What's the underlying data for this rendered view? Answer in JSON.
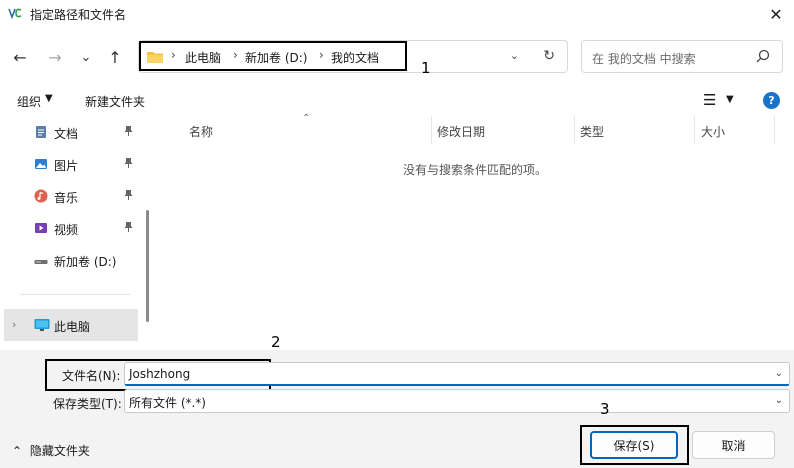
{
  "window": {
    "title": "指定路径和文件名",
    "close_glyph": "✕"
  },
  "nav": {
    "back_glyph": "←",
    "forward_glyph": "→",
    "recent_glyph": "⌄",
    "up_glyph": "↑"
  },
  "address": {
    "crumbs": [
      "此电脑",
      "新加卷 (D:)",
      "我的文档"
    ],
    "separator": "›",
    "dropdown_glyph": "⌄",
    "refresh_glyph": "↻"
  },
  "search": {
    "placeholder": "在 我的文档 中搜索"
  },
  "toolbar": {
    "organize": "组织",
    "organize_caret": "▼",
    "new_folder": "新建文件夹",
    "view_glyph": "☰",
    "view_caret": "▼",
    "help": "?"
  },
  "sidebar": {
    "items": [
      {
        "label": "文档",
        "icon": "document-icon",
        "pinned": true
      },
      {
        "label": "图片",
        "icon": "pictures-icon",
        "pinned": true
      },
      {
        "label": "音乐",
        "icon": "music-icon",
        "pinned": true
      },
      {
        "label": "视频",
        "icon": "video-icon",
        "pinned": true
      },
      {
        "label": "新加卷 (D:)",
        "icon": "drive-icon",
        "pinned": false
      },
      {
        "label": "此电脑",
        "icon": "computer-icon",
        "pinned": false
      }
    ],
    "pin_glyph": "📌",
    "chevron_glyph": "›"
  },
  "file_list": {
    "columns": [
      "名称",
      "修改日期",
      "类型",
      "大小"
    ],
    "sort_glyph": "⌃",
    "empty_message": "没有与搜索条件匹配的项。"
  },
  "form": {
    "filename_label": "文件名(N):",
    "filename_value": "Joshzhong",
    "filetype_label": "保存类型(T):",
    "filetype_value": "所有文件 (*.*)",
    "caret_glyph": "⌄"
  },
  "footer": {
    "hide_folders": "隐藏文件夹",
    "hide_caret": "⌃",
    "save_button": "保存(S)",
    "cancel_button": "取消"
  },
  "annotations": {
    "labels": [
      "1",
      "2",
      "3"
    ]
  },
  "colors": {
    "accent": "#0067c0",
    "folder_yellow": "#f4c142",
    "help_blue": "#1a73c9"
  }
}
